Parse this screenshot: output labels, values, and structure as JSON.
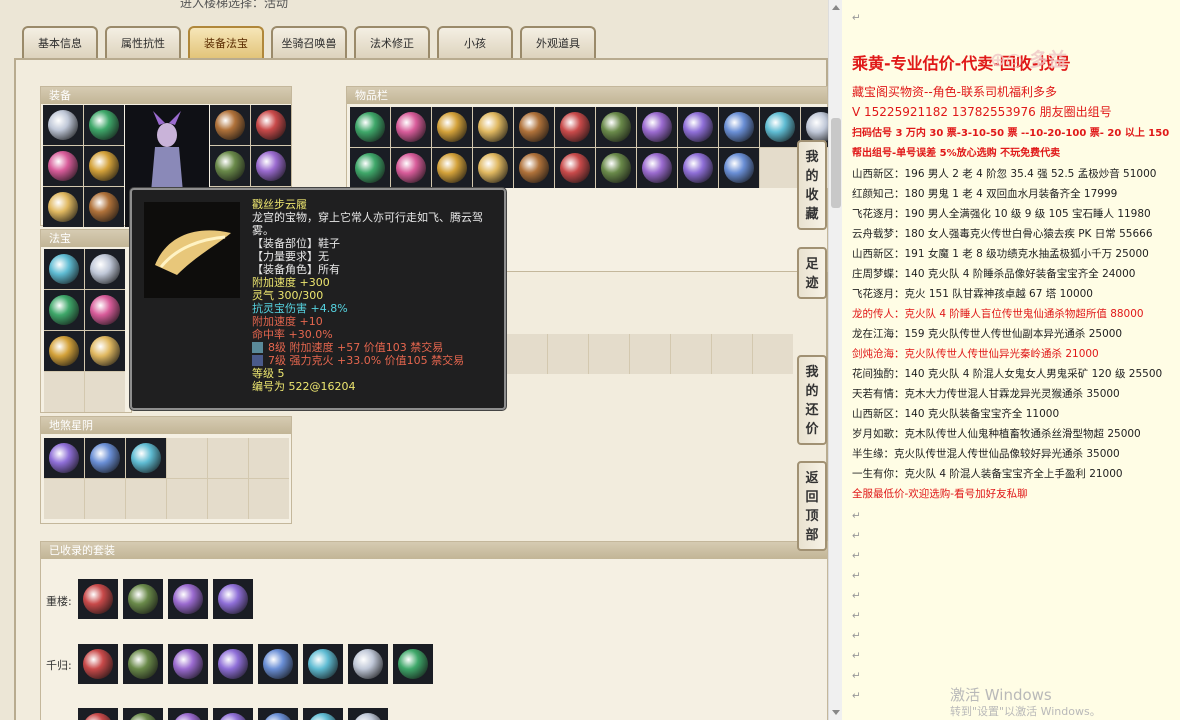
{
  "window": {
    "top_text": "进入楼梯选择：活动"
  },
  "tabs": [
    "基本信息",
    "属性抗性",
    "装备法宝",
    "坐骑召唤兽",
    "法术修正",
    "小孩",
    "外观道具"
  ],
  "active_tab": "装备法宝",
  "panels": {
    "equip": "装备",
    "inventory": "物品栏",
    "fabao": "法宝",
    "dungeon": "地煞星阴",
    "collection": "已收录的套装"
  },
  "collection_rows": [
    {
      "label": "重楼:"
    },
    {
      "label": "千归:"
    }
  ],
  "tooltip": {
    "name": "戳丝步云履",
    "desc1": "龙宫的宝物，穿上它常人亦可行走如飞、腾云驾",
    "desc2": "雾。",
    "lines": [
      {
        "text": "【装备部位】鞋子",
        "cls": "w"
      },
      {
        "text": "【力量要求】无",
        "cls": "w"
      },
      {
        "text": "【装备角色】所有",
        "cls": "w"
      },
      {
        "text": "附加速度 +300",
        "cls": "y"
      },
      {
        "text": "灵气 300/300",
        "cls": "y"
      },
      {
        "text": "抗灵宝伤害 +4.8%",
        "cls": "c"
      },
      {
        "text": "附加速度 +10",
        "cls": "r"
      },
      {
        "text": "命中率 +30.0%",
        "cls": "r"
      }
    ],
    "gem1": "8级 附加速度 +57 价值103 禁交易",
    "gem2": "7级 强力克火 +33.0% 价值105 禁交易",
    "level": "等级 5",
    "id": "编号为 522@16204"
  },
  "side_buttons": [
    [
      "我",
      "的",
      "收",
      "藏"
    ],
    [
      "足",
      "迹"
    ],
    [
      "我",
      "的",
      "还",
      "价"
    ],
    [
      "返",
      "回",
      "顶",
      "部"
    ]
  ],
  "doc": {
    "title": "乘黄-专业估价-代卖-回收-找号",
    "l1": "藏宝阁买物资--角色-联系司机福利多多",
    "l2": "V 15225921182    13782553976 朋友圈出组号",
    "l3": "扫码估号 3 万内 30 票-3-10-50 票  --10-20-100 票- 20 以上 150",
    "l4": "帮出组号-单号误差 5%放心选购 不玩免费代卖",
    "rows": [
      {
        "text": "山西新区：196 男人 2 老 4 阶忽 35.4 强 52.5 孟极炒音 51000",
        "cls": "dark"
      },
      {
        "text": "红颜知己：180 男鬼 1 老 4 双回血水月装备齐全 17999",
        "cls": "dark"
      },
      {
        "text": "飞花逐月：190 男人全满强化 10 级 9 级 105 宝石睡人 11980",
        "cls": "dark"
      },
      {
        "text": "云舟载梦：180 女人强毒克火传世白骨心猿去疾 PK 日常 55666",
        "cls": "dark"
      },
      {
        "text": "山西新区：191 女魔 1 老 8 级功绩克水抽孟极狐小千万 25000",
        "cls": "dark"
      },
      {
        "text": "庄周梦蝶：140 克火队 4 阶睡杀品像好装备宝宝齐全 24000",
        "cls": "dark"
      },
      {
        "text": "飞花逐月：克火 151 队甘霖神孩卓越 67 塔 10000",
        "cls": "dark"
      },
      {
        "text": "龙的传人：克火队 4 阶睡人盲位传世鬼仙通杀物超所值 88000",
        "cls": "red"
      },
      {
        "text": "龙在江海：159 克火队传世人传世仙副本异光通杀 25000",
        "cls": "dark"
      },
      {
        "text": "剑炖沧海：克火队传世人传世仙异光秦岭通杀 21000",
        "cls": "red"
      },
      {
        "text": "花间独酌：140 克火队 4 阶混人女鬼女人男鬼采矿 120 级 25500",
        "cls": "dark"
      },
      {
        "text": "天若有情：克木大力传世混人甘霖龙异光灵猴通杀 35000",
        "cls": "dark"
      },
      {
        "text": "山西新区：140 克火队装备宝宝齐全 11000",
        "cls": "dark"
      },
      {
        "text": "岁月如歌：克木队传世人仙鬼种植畜牧通杀丝滑型物超 25000",
        "cls": "dark"
      },
      {
        "text": "半生缘：克火队传世混人传世仙品像较好异光通杀 35000",
        "cls": "dark"
      },
      {
        "text": "一生有你：克火队 4 阶混人装备宝宝齐全上手盈利 21000",
        "cls": "dark"
      },
      {
        "text": "全服最低价-欢迎选购-看号加好友私聊",
        "cls": "red"
      }
    ],
    "marker": "↵",
    "watermark": "激活 Windows",
    "watermark_sub": "转到\"设置\"以激活 Windows。",
    "logo": "⊕◎ 多益"
  },
  "colors": {
    "red": "#e01818",
    "gold": "#e2c47a",
    "tooltip_bg": "#1f1f20"
  }
}
